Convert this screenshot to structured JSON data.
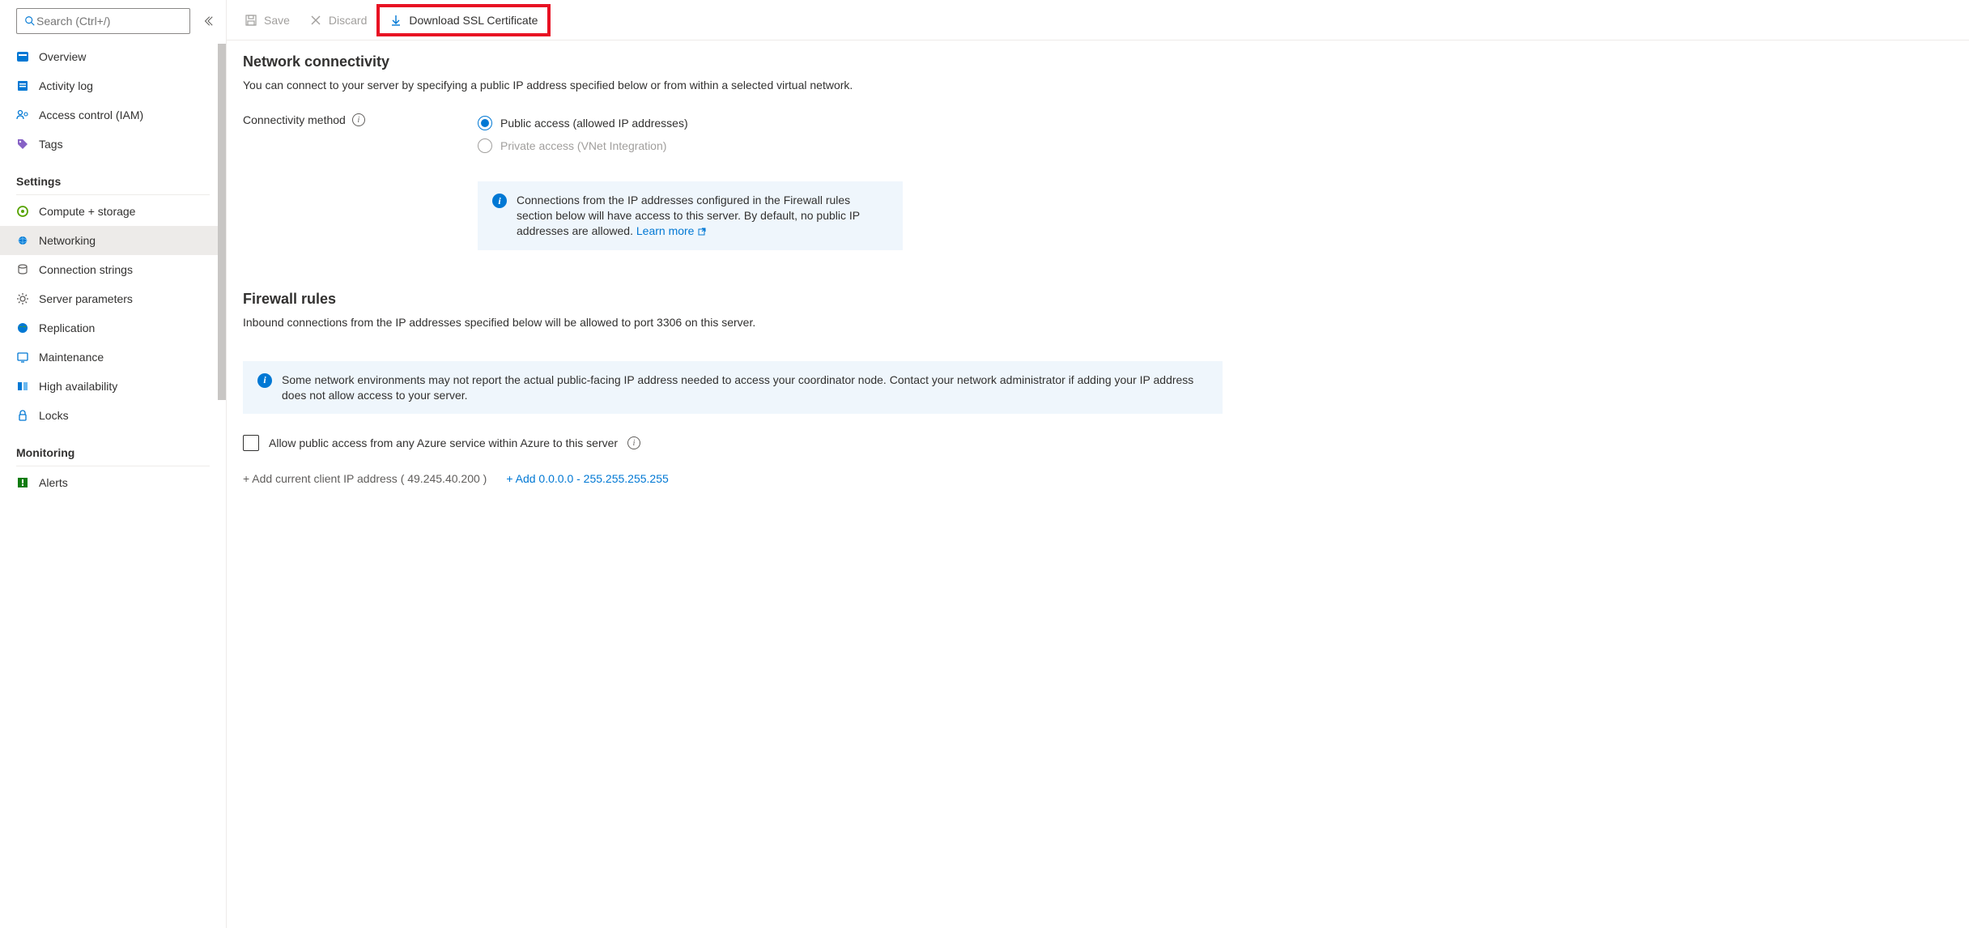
{
  "sidebar": {
    "search_placeholder": "Search (Ctrl+/)",
    "items": [
      {
        "icon": "overview",
        "label": "Overview"
      },
      {
        "icon": "activity",
        "label": "Activity log"
      },
      {
        "icon": "iam",
        "label": "Access control (IAM)"
      },
      {
        "icon": "tags",
        "label": "Tags"
      }
    ],
    "group_settings": "Settings",
    "settings_items": [
      {
        "icon": "compute",
        "label": "Compute + storage"
      },
      {
        "icon": "networking",
        "label": "Networking",
        "selected": true
      },
      {
        "icon": "connstr",
        "label": "Connection strings"
      },
      {
        "icon": "params",
        "label": "Server parameters"
      },
      {
        "icon": "replication",
        "label": "Replication"
      },
      {
        "icon": "maintenance",
        "label": "Maintenance"
      },
      {
        "icon": "ha",
        "label": "High availability"
      },
      {
        "icon": "locks",
        "label": "Locks"
      }
    ],
    "group_monitoring": "Monitoring",
    "monitoring_items": [
      {
        "icon": "alerts",
        "label": "Alerts"
      }
    ]
  },
  "toolbar": {
    "save": "Save",
    "discard": "Discard",
    "download": "Download SSL Certificate"
  },
  "content": {
    "section1_title": "Network connectivity",
    "section1_desc": "You can connect to your server by specifying a public IP address specified below or from within a selected virtual network.",
    "conn_method_label": "Connectivity method",
    "radio_public": "Public access (allowed IP addresses)",
    "radio_private": "Private access (VNet Integration)",
    "info1_text": "Connections from the IP addresses configured in the Firewall rules section below will have access to this server. By default, no public IP addresses are allowed. ",
    "info1_link": "Learn more",
    "section2_title": "Firewall rules",
    "section2_desc": "Inbound connections from the IP addresses specified below will be allowed to port 3306 on this server.",
    "info2_text": "Some network environments may not report the actual public-facing IP address needed to access your coordinator node. Contact your network administrator if adding your IP address does not allow access to your server.",
    "allow_azure": "Allow public access from any Azure service within Azure to this server",
    "add_client": "+ Add current client IP address ( 49.245.40.200 )",
    "add_any": "+ Add 0.0.0.0 - 255.255.255.255"
  }
}
